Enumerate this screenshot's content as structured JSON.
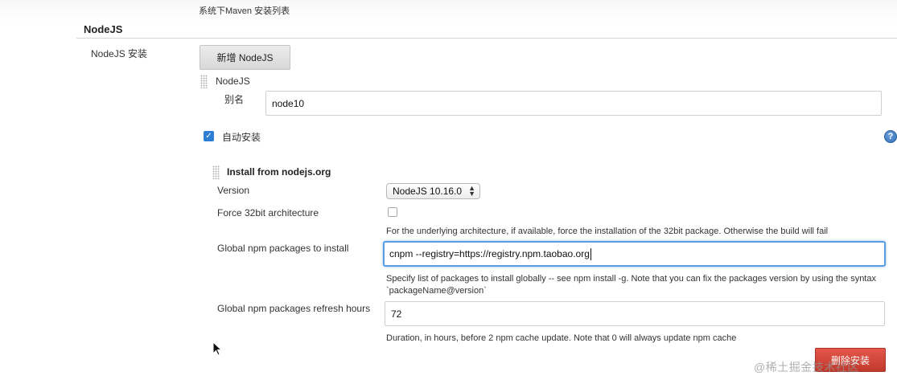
{
  "header": {
    "caption": "系统下Maven 安装列表",
    "section_title": "NodeJS"
  },
  "installations": {
    "label": "NodeJS 安装",
    "add_button": "新增 NodeJS"
  },
  "node": {
    "title": "NodeJS",
    "alias_label": "别名",
    "alias_value": "node10",
    "auto_install_label": "自动安装",
    "auto_install_checked": true,
    "help_glyph": "?"
  },
  "installer": {
    "title": "Install from nodejs.org",
    "version_label": "Version",
    "version_value": "NodeJS 10.16.0",
    "force32_label": "Force 32bit architecture",
    "force32_checked": false,
    "force32_help": "For the underlying architecture, if available, force the installation of the 32bit package. Otherwise the build will fail",
    "npm_label": "Global npm packages to install",
    "npm_value": "cnpm --registry=https://registry.npm.taobao.org",
    "npm_help": "Specify list of packages to install globally -- see npm install -g. Note that you can fix the packages version by using the syntax `packageName@version`",
    "refresh_label": "Global npm packages refresh hours",
    "refresh_value": "72",
    "refresh_help": "Duration, in hours, before 2 npm cache update. Note that 0 will always update npm cache"
  },
  "actions": {
    "delete_button": "删除安装"
  },
  "watermark": "@稀土掘金技术社区",
  "colors": {
    "accent": "#2d7fd6",
    "focus_border": "#5b9be0",
    "danger": "#c0392b"
  }
}
